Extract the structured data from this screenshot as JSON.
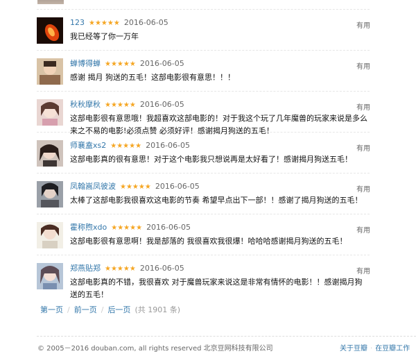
{
  "comments": [
    {
      "user": "123",
      "stars": "★★★★★",
      "date": "2016-06-05",
      "useful": "有用",
      "text": "我已经等了你一万年"
    },
    {
      "user": "蝉博得蝉",
      "stars": "★★★★★",
      "date": "2016-06-05",
      "useful": "有用",
      "text": "感谢 揭月 狗送的五毛！这部电影很有意思！！！"
    },
    {
      "user": "秋秋摩秋",
      "stars": "★★★★★",
      "date": "2016-06-05",
      "useful": "有用",
      "text": "这部电影很有意思哦！我超喜欢这部电影的！对于我这个玩了几年魔兽的玩家来说是多么来之不易的电影!必须点赞 必须好评！感谢揭月狗送的五毛！"
    },
    {
      "user": "师襄盍xs2",
      "stars": "★★★★★",
      "date": "2016-06-05",
      "useful": "有用",
      "text": "这部电影真的很有意思！对于这个电影我只想说再是太好看了！感谢揭月狗送五毛！"
    },
    {
      "user": "凤翰嵩凤彼波",
      "stars": "★★★★★",
      "date": "2016-06-05",
      "useful": "有用",
      "text": "太棒了这部电影我很喜欢这电影的节奏 希望早点出下一部！！感谢了揭月狗送的五毛！"
    },
    {
      "user": "霍称煦xdo",
      "stars": "★★★★★",
      "date": "2016-06-05",
      "useful": "有用",
      "text": "这部电影很有意思啊！我是部落的 我很喜欢我很爆！哈哈哈感谢揭月狗送的五毛！"
    },
    {
      "user": "郑燕贴郑",
      "stars": "★★★★★",
      "date": "2016-06-05",
      "useful": "有用",
      "text": "这部电影真的不错，我很喜欢 对于魔兽玩家来说这是非常有情怀的电影！！感谢揭月狗送的五毛！"
    }
  ],
  "pager": {
    "first": "第一页",
    "prev": "前一页",
    "next": "后一页",
    "total": "(共 1901 条)",
    "sep": "/"
  },
  "footer": {
    "copyright": "© 2005－2016 douban.com, all rights reserved 北京豆网科技有限公司",
    "about": "关于豆瓣",
    "jobs": "在豆瓣工作",
    "sep": "·"
  },
  "colors": {
    "link": "#3377aa",
    "star": "#f5a623",
    "muted": "#666666"
  }
}
